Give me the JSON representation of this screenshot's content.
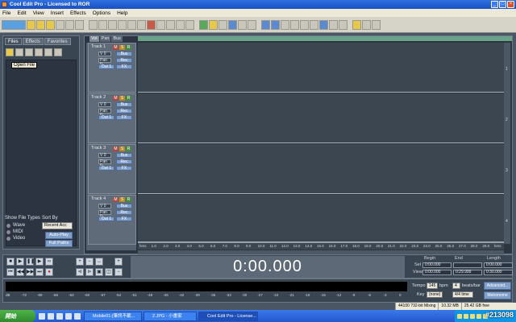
{
  "window": {
    "title": "Cool Edit Pro - Licensed to ROR"
  },
  "menu": [
    "File",
    "Edit",
    "View",
    "Insert",
    "Effects",
    "Options",
    "Help"
  ],
  "left_panel": {
    "tabs": [
      "Files",
      "Effects",
      "Favorites"
    ],
    "open_file_label": "Open File",
    "show_file_types_label": "Show File Types",
    "sort_by_label": "Sort By",
    "file_types": [
      "Wave",
      "MIDI",
      "Video"
    ],
    "sort_value": "Recent Acc",
    "auto_play_label": "Auto-Play",
    "full_paths_label": "Full Paths"
  },
  "track_tabs": [
    "Vol",
    "Pan",
    "Bus"
  ],
  "tracks": [
    {
      "name": "Track 1",
      "vol": "V 0",
      "pan": "Pan 0",
      "out": "Out 1",
      "fx": "FX"
    },
    {
      "name": "Track 2",
      "vol": "V 0",
      "pan": "Pan 0",
      "out": "Out 1",
      "fx": "FX"
    },
    {
      "name": "Track 3",
      "vol": "V 0",
      "pan": "Pan 0",
      "out": "Out 1",
      "fx": "FX"
    },
    {
      "name": "Track 4",
      "vol": "V 0",
      "pan": "Pan 0",
      "out": "Out 1",
      "fx": "FX"
    }
  ],
  "track_buttons": {
    "mute": "M",
    "solo": "S",
    "record": "R",
    "bus": "Bus",
    "rec": "Rec"
  },
  "ruler": {
    "labels": [
      "hms",
      "1.0",
      "2.0",
      "3.0",
      "4.0",
      "5.0",
      "6.0",
      "7.0",
      "8.0",
      "9.0",
      "10.0",
      "11.0",
      "12.0",
      "13.0",
      "14.0",
      "15.0",
      "16.0",
      "17.0",
      "18.0",
      "19.0",
      "20.0",
      "21.0",
      "22.0",
      "23.0",
      "24.0",
      "25.0",
      "26.0",
      "27.0",
      "28.0",
      "29.0",
      "hms"
    ]
  },
  "lane_numbers": [
    "1",
    "2",
    "3",
    "4"
  ],
  "transport": {
    "time": "0:00.000"
  },
  "selection": {
    "headers": [
      "Begin",
      "End",
      "Length"
    ],
    "rows": [
      {
        "label": "Sel",
        "begin": "0:00.000",
        "end": "",
        "length": "0:00.000"
      },
      {
        "label": "View",
        "begin": "0:00.000",
        "end": "0:29.999",
        "length": "0:30.000"
      }
    ]
  },
  "meter_scale": [
    "dB",
    "-72",
    "-69",
    "-66",
    "-63",
    "-60",
    "-57",
    "-54",
    "-51",
    "-48",
    "-45",
    "-42",
    "-39",
    "-36",
    "-33",
    "-30",
    "-27",
    "-24",
    "-21",
    "-18",
    "-15",
    "-12",
    "-9",
    "-6",
    "-3",
    "0"
  ],
  "tempo": {
    "tempo_label": "Tempo",
    "tempo_value": "145",
    "bpm_label": "bpm",
    "beats_value": "4",
    "beats_label": "beats/bar",
    "key_label": "Key",
    "key_value": "(none)",
    "time_sig": "4/4 time",
    "advanced_label": "Advanced...",
    "metronome_label": "Metronome"
  },
  "status": {
    "format": "44100 ?32-bit Mixing",
    "size": "10.32 MB",
    "free": "25.42 GB free"
  },
  "taskbar": {
    "start": "開始",
    "tasks": [
      "Mobile01-[筆訊不載...",
      "2.JPG - 小畫家",
      "Cool Edit Pro - License..."
    ],
    "clock": "",
    "watermark": "#213098"
  }
}
